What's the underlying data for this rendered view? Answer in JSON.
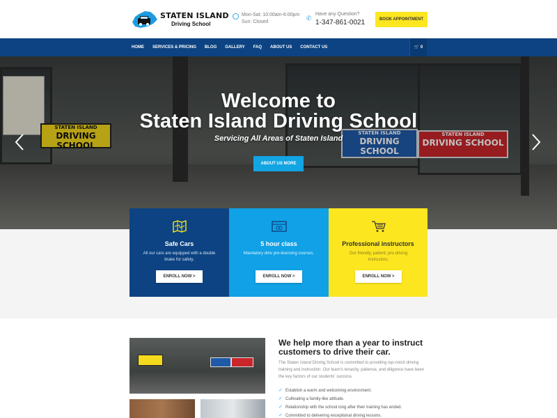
{
  "brand": {
    "name_line1": "STATEN ISLAND",
    "name_line2": "Driving School",
    "accent_blue": "#0d4382",
    "accent_sky": "#10a1e6",
    "accent_yellow": "#fce620"
  },
  "header": {
    "hours_line1": "Mon-Sat: 10:00am-6:00pm",
    "hours_line2": "Sun: Closed",
    "question_label": "Have any Question?",
    "phone": "1-347-861-0021",
    "book_button": "BOOK APPOINTMENT"
  },
  "nav": {
    "items": [
      "HOME",
      "SERVICES & PRICING",
      "BLOG",
      "GALLERY",
      "FAQ",
      "ABOUT US",
      "CONTACT US"
    ],
    "cart_count": "0"
  },
  "hero": {
    "title_line1": "Welcome to",
    "title_line2": "Staten Island Driving School",
    "subtitle": "Servicing All Areas of Staten Island",
    "button": "ABOUT US MORE",
    "signs": {
      "y_line1": "STATEN ISLAND",
      "y_line2": "DRIVING SCHOOL",
      "b_line1": "STATEN ISLAND",
      "b_line2": "DRIVING SCHOOL",
      "r_line1": "STATEN ISLAND",
      "r_line2": "DRIVING SCHOOL"
    }
  },
  "features": [
    {
      "icon": "map-icon",
      "title": "Safe Cars",
      "description": "All our cars are equipped with a double brake for safety.",
      "button": "ENROLL NOW >"
    },
    {
      "icon": "ticket-icon",
      "title": "5 hour class",
      "description": "Mandatory dmv pre-licensing courses.",
      "button": "ENROLL NOW >"
    },
    {
      "icon": "cart-icon",
      "title": "Professional instructors",
      "description": "Our friendly, patient, pro driving instructors.",
      "button": "ENROLL NOW >"
    }
  ],
  "about": {
    "heading": "We help more than a year to instruct customers to drive their car.",
    "paragraph": "The Staten Island Driving School is committed to providing top-notch driving training and instruction. Our team's tenacity, patience, and diligence have been the key factors of our students' success.",
    "checklist": [
      "Establish a warm and welcoming environment.",
      "Cultivating a family-like attitude.",
      "Relationship with the school long after their training has ended.",
      "Committed to delivering exceptional driving lessons."
    ]
  }
}
